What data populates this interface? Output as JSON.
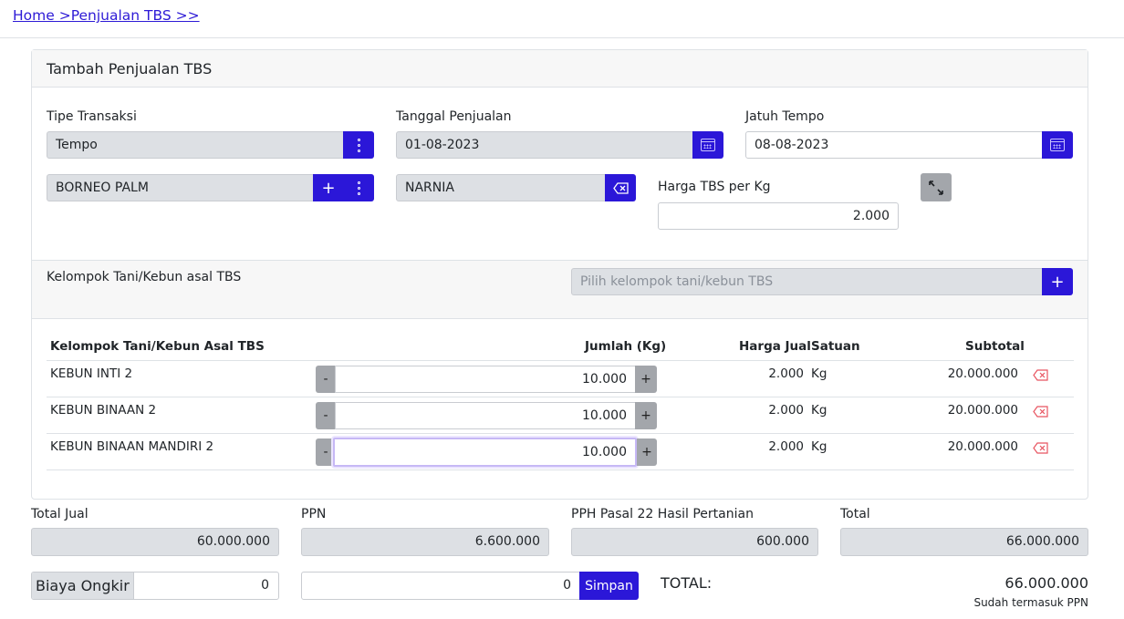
{
  "breadcrumb": "Home >Penjualan TBS >>",
  "card": {
    "title": "Tambah Penjualan TBS"
  },
  "form": {
    "tipe_transaksi_label": "Tipe Transaksi",
    "tipe_transaksi_value": "Tempo",
    "tanggal_label": "Tanggal Penjualan",
    "tanggal_value": "01-08-2023",
    "jatuh_tempo_label": "Jatuh Tempo",
    "jatuh_tempo_value": "08-08-2023",
    "customer_value": "BORNEO PALM",
    "sales_value": "NARNIA",
    "harga_label": "Harga TBS per Kg",
    "harga_value": "2.000"
  },
  "kelompok": {
    "label": "Kelompok Tani/Kebun asal TBS",
    "placeholder": "Pilih kelompok tani/kebun TBS"
  },
  "table": {
    "headers": {
      "kelompok": "Kelompok Tani/Kebun Asal TBS",
      "jumlah": "Jumlah (Kg)",
      "harga_jual": "Harga Jual",
      "satuan": "Satuan",
      "subtotal": "Subtotal"
    },
    "rows": [
      {
        "name": "KEBUN INTI 2",
        "jumlah": "10.000",
        "harga": "2.000",
        "satuan": "Kg",
        "subtotal": "20.000.000"
      },
      {
        "name": "KEBUN BINAAN 2",
        "jumlah": "10.000",
        "harga": "2.000",
        "satuan": "Kg",
        "subtotal": "20.000.000"
      },
      {
        "name": "KEBUN BINAAN MANDIRI 2",
        "jumlah": "10.000",
        "harga": "2.000",
        "satuan": "Kg",
        "subtotal": "20.000.000"
      }
    ],
    "minus_label": "-",
    "plus_label": "+"
  },
  "summary": {
    "total_jual_label": "Total Jual",
    "total_jual_value": "60.000.000",
    "ppn_label": "PPN",
    "ppn_value": "6.600.000",
    "pph_label": "PPH Pasal 22 Hasil Pertanian",
    "pph_value": "600.000",
    "total_label": "Total",
    "total_value": "66.000.000"
  },
  "footer": {
    "ongkir_label": "Biaya Ongkir",
    "ongkir_value": "0",
    "amount_value": "0",
    "simpan_label": "Simpan",
    "grand_total_label": "TOTAL:",
    "grand_total_value": "66.000.000",
    "grand_total_note": "Sudah termasuk PPN"
  },
  "colors": {
    "primary": "#2b17d8",
    "danger": "#e85561",
    "readonly_bg": "#dde0e4"
  }
}
